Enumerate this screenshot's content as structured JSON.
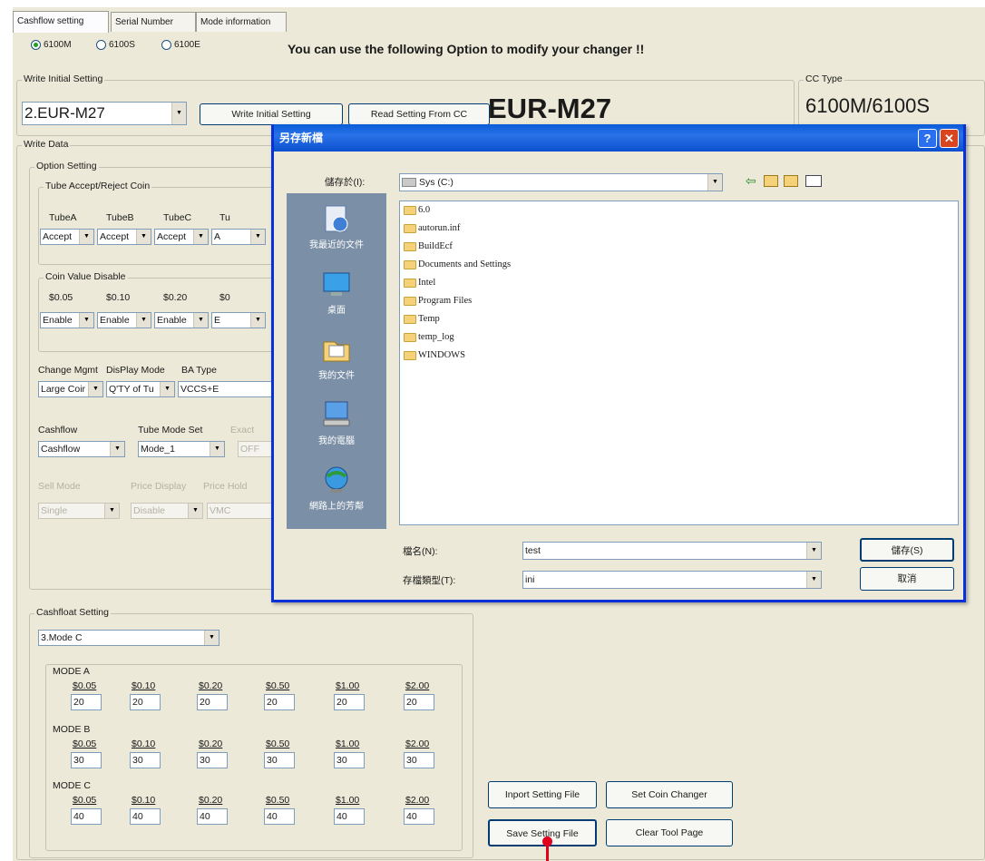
{
  "tabs": [
    "Cashflow setting",
    "Serial Number",
    "Mode information"
  ],
  "models": [
    {
      "label": "6100M",
      "selected": true
    },
    {
      "label": "6100S",
      "selected": false
    },
    {
      "label": "6100E",
      "selected": false
    }
  ],
  "banner": "You can use the following Option to modify your changer !!",
  "write_initial": {
    "title": "Write Initial Setting",
    "selected": "2.EUR-M27",
    "write_button": "Write Initial Setting",
    "read_button": "Read Setting From CC",
    "current_config": "EUR-M27"
  },
  "cc_type": {
    "title": "CC Type",
    "value": "6100M/6100S"
  },
  "write_data": {
    "title": "Write Data",
    "option_setting": "Option Setting",
    "tube_group": "Tube Accept/Reject Coin",
    "tube_labels": [
      "TubeA",
      "TubeB",
      "TubeC",
      "Tu"
    ],
    "tube_values": [
      "Accept",
      "Accept",
      "Accept",
      "A"
    ],
    "coin_group": "Coin Value Disable",
    "coin_labels": [
      "$0.05",
      "$0.10",
      "$0.20",
      "$0"
    ],
    "coin_values": [
      "Enable",
      "Enable",
      "Enable",
      "E"
    ],
    "mgmt_labels": [
      "Change Mgmt",
      "DisPlay Mode",
      "BA Type"
    ],
    "mgmt_values": [
      "Large Coir",
      "Q'TY of Tu",
      "VCCS+E"
    ],
    "cashflow_label": "Cashflow",
    "tube_mode_label": "Tube Mode Set",
    "exact_label": "Exact",
    "cashflow_value": "Cashflow",
    "tube_mode_value": "Mode_1",
    "exact_value": "OFF",
    "sell_labels": [
      "Sell Mode",
      "Price Display",
      "Price Hold"
    ],
    "sell_values": [
      "Single",
      "Disable",
      "VMC"
    ]
  },
  "cashfloat": {
    "title": "Cashfloat Setting",
    "selected": "3.Mode C",
    "denoms": [
      "$0.05",
      "$0.10",
      "$0.20",
      "$0.50",
      "$1.00",
      "$2.00"
    ],
    "modes": [
      {
        "name": "MODE A",
        "values": [
          "20",
          "20",
          "20",
          "20",
          "20",
          "20"
        ]
      },
      {
        "name": "MODE B",
        "values": [
          "30",
          "30",
          "30",
          "30",
          "30",
          "30"
        ]
      },
      {
        "name": "MODE C",
        "values": [
          "40",
          "40",
          "40",
          "40",
          "40",
          "40"
        ]
      }
    ]
  },
  "buttons": {
    "import": "Inport Setting File",
    "set_changer": "Set Coin Changer",
    "save": "Save Setting File",
    "clear": "Clear Tool Page"
  },
  "dialog": {
    "title": "另存新檔",
    "save_in_label": "儲存於(I):",
    "save_in_value": "Sys (C:)",
    "places": [
      "我最近的文件",
      "桌面",
      "我的文件",
      "我的電腦",
      "網路上的芳鄰"
    ],
    "files": [
      "6.0",
      "autorun.inf",
      "BuildEcf",
      "Documents and Settings",
      "Intel",
      "Program Files",
      "Temp",
      "temp_log",
      "WINDOWS"
    ],
    "filename_label": "檔名(N):",
    "filename_value": "test",
    "filetype_label": "存檔類型(T):",
    "filetype_value": "ini",
    "save_button": "儲存(S)",
    "cancel_button": "取消"
  }
}
